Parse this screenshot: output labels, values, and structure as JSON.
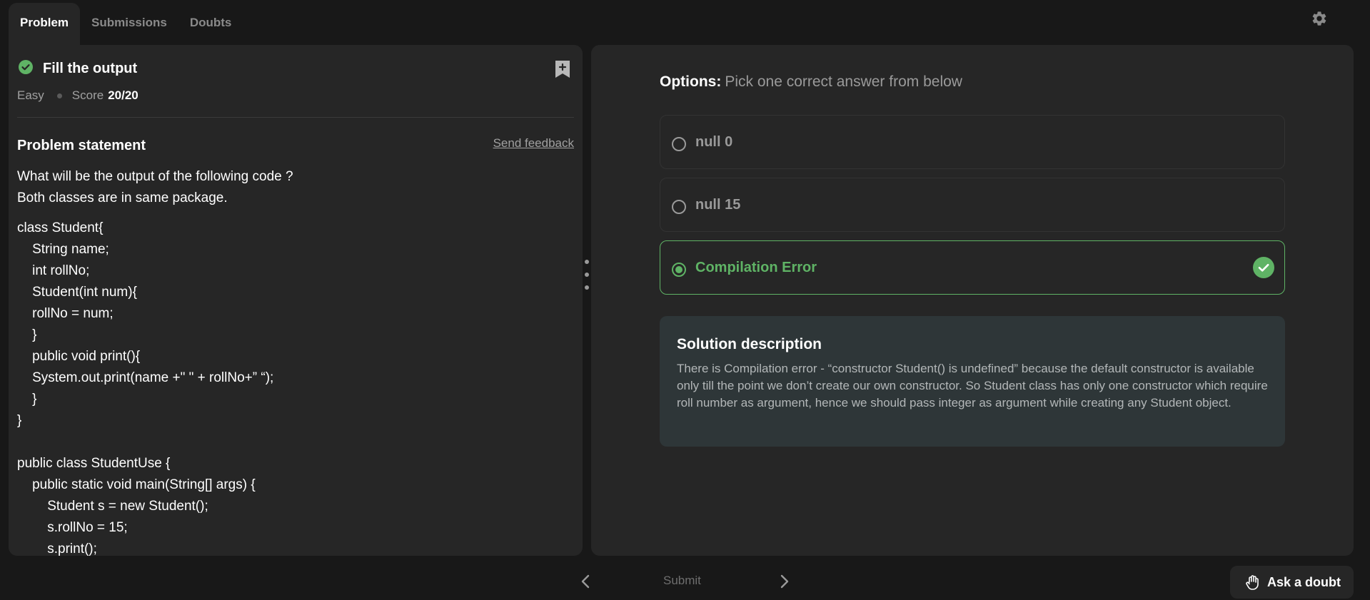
{
  "tabs": [
    {
      "label": "Problem",
      "active": true
    },
    {
      "label": "Submissions",
      "active": false
    },
    {
      "label": "Doubts",
      "active": false
    }
  ],
  "problem": {
    "title": "Fill the output",
    "difficulty": "Easy",
    "score_label": "Score",
    "score_value": "20/20",
    "statement_heading": "Problem statement",
    "feedback_label": "Send feedback",
    "statement_lines": [
      "What will be the output of the following code ?",
      "Both classes are in same package."
    ],
    "code_lines": [
      "class Student{",
      "    String name;",
      "    int rollNo;",
      "    Student(int num){",
      "    rollNo = num;",
      "    }",
      "    public void print(){",
      "    System.out.print(name +\" \" + rollNo+” “);",
      "    }",
      "}",
      "",
      "public class StudentUse {",
      "    public static void main(String[] args) {",
      "        Student s = new Student();",
      "        s.rollNo = 15;",
      "        s.print();"
    ]
  },
  "options": {
    "heading": "Options:",
    "subheading": "Pick one correct answer from below",
    "items": [
      {
        "label": "null 0",
        "selected": false
      },
      {
        "label": "null 15",
        "selected": false
      },
      {
        "label": "Compilation Error",
        "selected": true,
        "correct": true
      }
    ]
  },
  "solution": {
    "title": "Solution description",
    "text": "There is Compilation error - “constructor Student() is undefined” because the default constructor is available only till the point we don’t create our own constructor. So Student class has only one constructor which require roll number as argument, hence we should pass integer as argument while creating any Student object."
  },
  "footer": {
    "submit_label": "Submit",
    "ask_label": "Ask a doubt"
  },
  "colors": {
    "background": "#181818",
    "panel": "#262626",
    "accent_green": "#5fb365",
    "solution_bg": "#2e3638"
  },
  "icons": [
    "gear-icon",
    "check-circle-icon",
    "bookmark-plus-icon",
    "chevron-left-icon",
    "chevron-right-icon",
    "hand-icon",
    "correct-check-icon"
  ]
}
